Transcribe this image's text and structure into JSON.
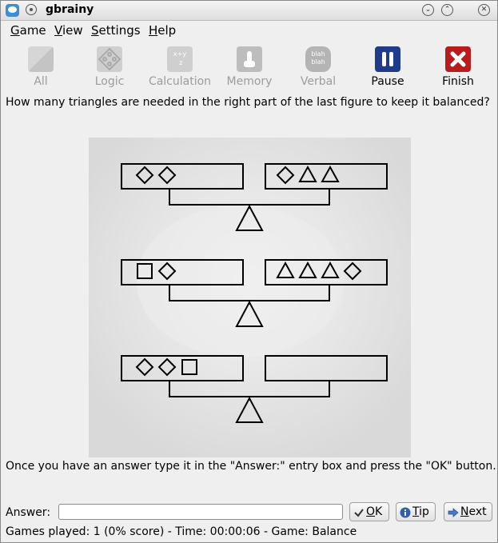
{
  "window": {
    "title": "gbrainy"
  },
  "menubar": {
    "items": [
      {
        "label": "Game",
        "mnemonic": "G",
        "rest": "ame"
      },
      {
        "label": "View",
        "mnemonic": "V",
        "rest": "iew"
      },
      {
        "label": "Settings",
        "mnemonic": "S",
        "rest": "ettings"
      },
      {
        "label": "Help",
        "mnemonic": "H",
        "rest": "elp"
      }
    ]
  },
  "toolbar": {
    "all": "All",
    "logic": "Logic",
    "calculation": "Calculation",
    "memory": "Memory",
    "verbal": "Verbal",
    "pause": "Pause",
    "finish": "Finish",
    "pause_color": "#1f3c8c",
    "finish_color": "#b81c1c",
    "calc_icon_text": "x+y\n z",
    "verbal_icon_text": "blah\nblah"
  },
  "question": "How many triangles are needed in the right part of the last figure to keep it balanced?",
  "puzzle": {
    "rows": [
      {
        "left": [
          "diamond",
          "diamond"
        ],
        "right": [
          "diamond",
          "triangle",
          "triangle"
        ]
      },
      {
        "left": [
          "square",
          "diamond"
        ],
        "right": [
          "triangle",
          "triangle",
          "triangle",
          "diamond"
        ]
      },
      {
        "left": [
          "diamond",
          "diamond",
          "square"
        ],
        "right": []
      }
    ]
  },
  "instructions": "Once you have an answer type it in the \"Answer:\" entry box and press the \"OK\" button.",
  "answer": {
    "label": "Answer:",
    "value": "",
    "ok_label": "OK",
    "ok_mnemonic": "O",
    "ok_rest": "K",
    "tip_label": "Tip",
    "tip_mnemonic": "T",
    "tip_rest": "ip",
    "next_label": "Next",
    "next_mnemonic": "N",
    "next_rest": "ext"
  },
  "status": "Games played: 1 (0% score) - Time: 00:00:06 - Game: Balance"
}
